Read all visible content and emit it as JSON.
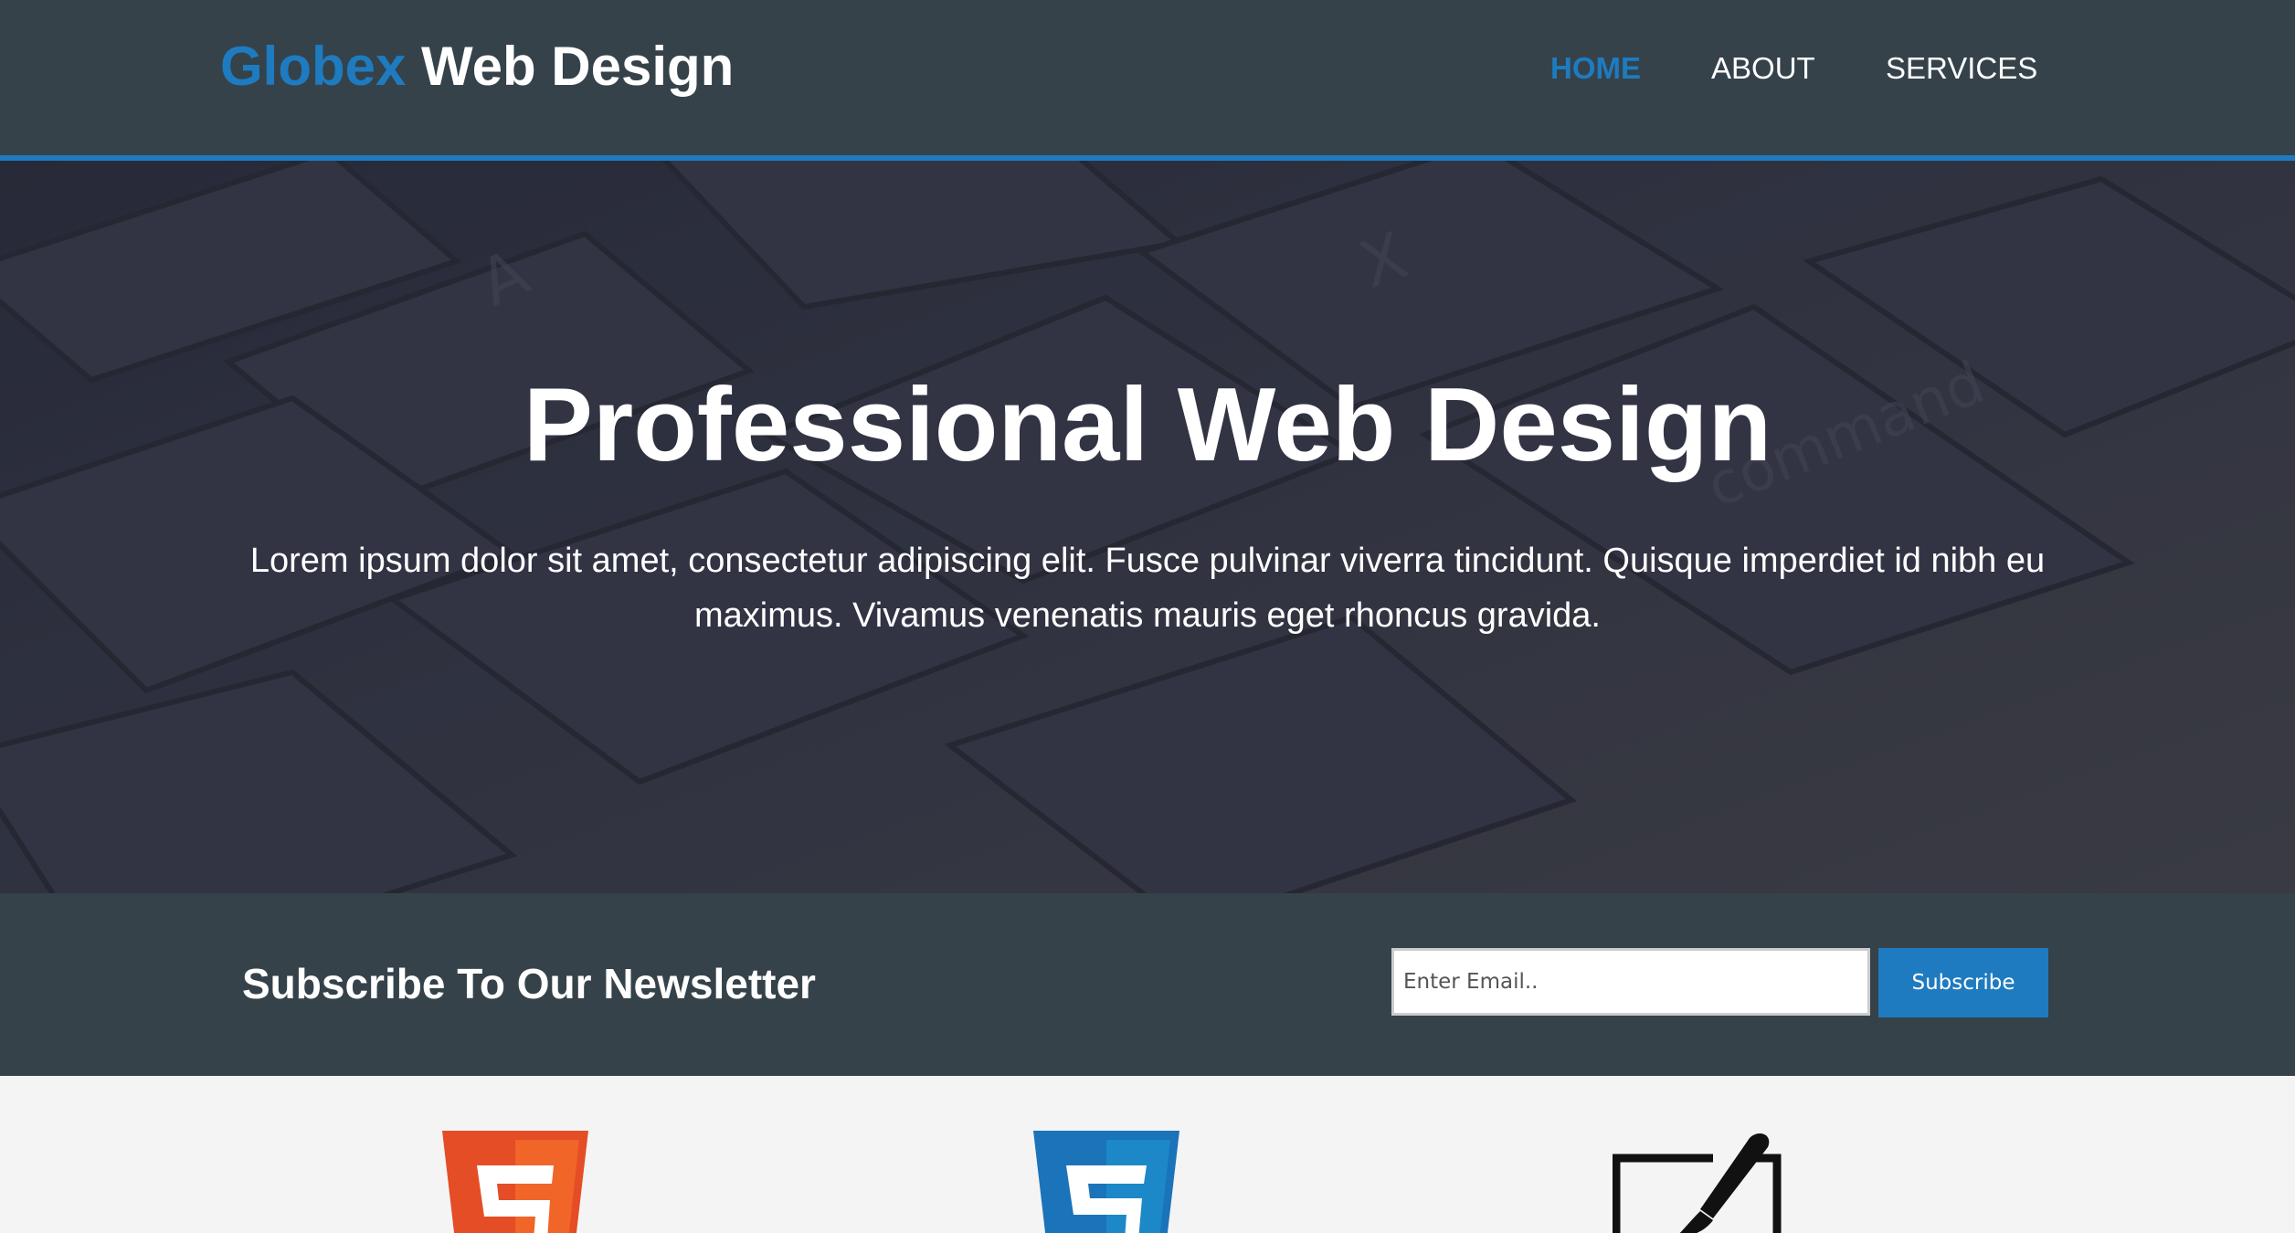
{
  "header": {
    "brand_accent": "Globex",
    "brand_rest": " Web Design",
    "nav": [
      {
        "label": "HOME",
        "active": true
      },
      {
        "label": "ABOUT",
        "active": false
      },
      {
        "label": "SERVICES",
        "active": false
      }
    ]
  },
  "hero": {
    "title": "Professional Web Design",
    "text": "Lorem ipsum dolor sit amet, consectetur adipiscing elit. Fusce pulvinar viverra tincidunt. Quisque imperdiet id nibh eu maximus. Vivamus venenatis mauris eget rhoncus gravida."
  },
  "newsletter": {
    "heading": "Subscribe To Our Newsletter",
    "email_placeholder": "Enter Email..",
    "button_label": "Subscribe"
  },
  "boxes": {
    "icons": [
      "html5-icon",
      "css3-icon",
      "brush-icon"
    ]
  },
  "colors": {
    "header_bg": "#35424a",
    "accent": "#1e7bc0",
    "page_bg": "#f4f4f4",
    "html5": "#e44d26",
    "css3": "#1b73ba"
  }
}
